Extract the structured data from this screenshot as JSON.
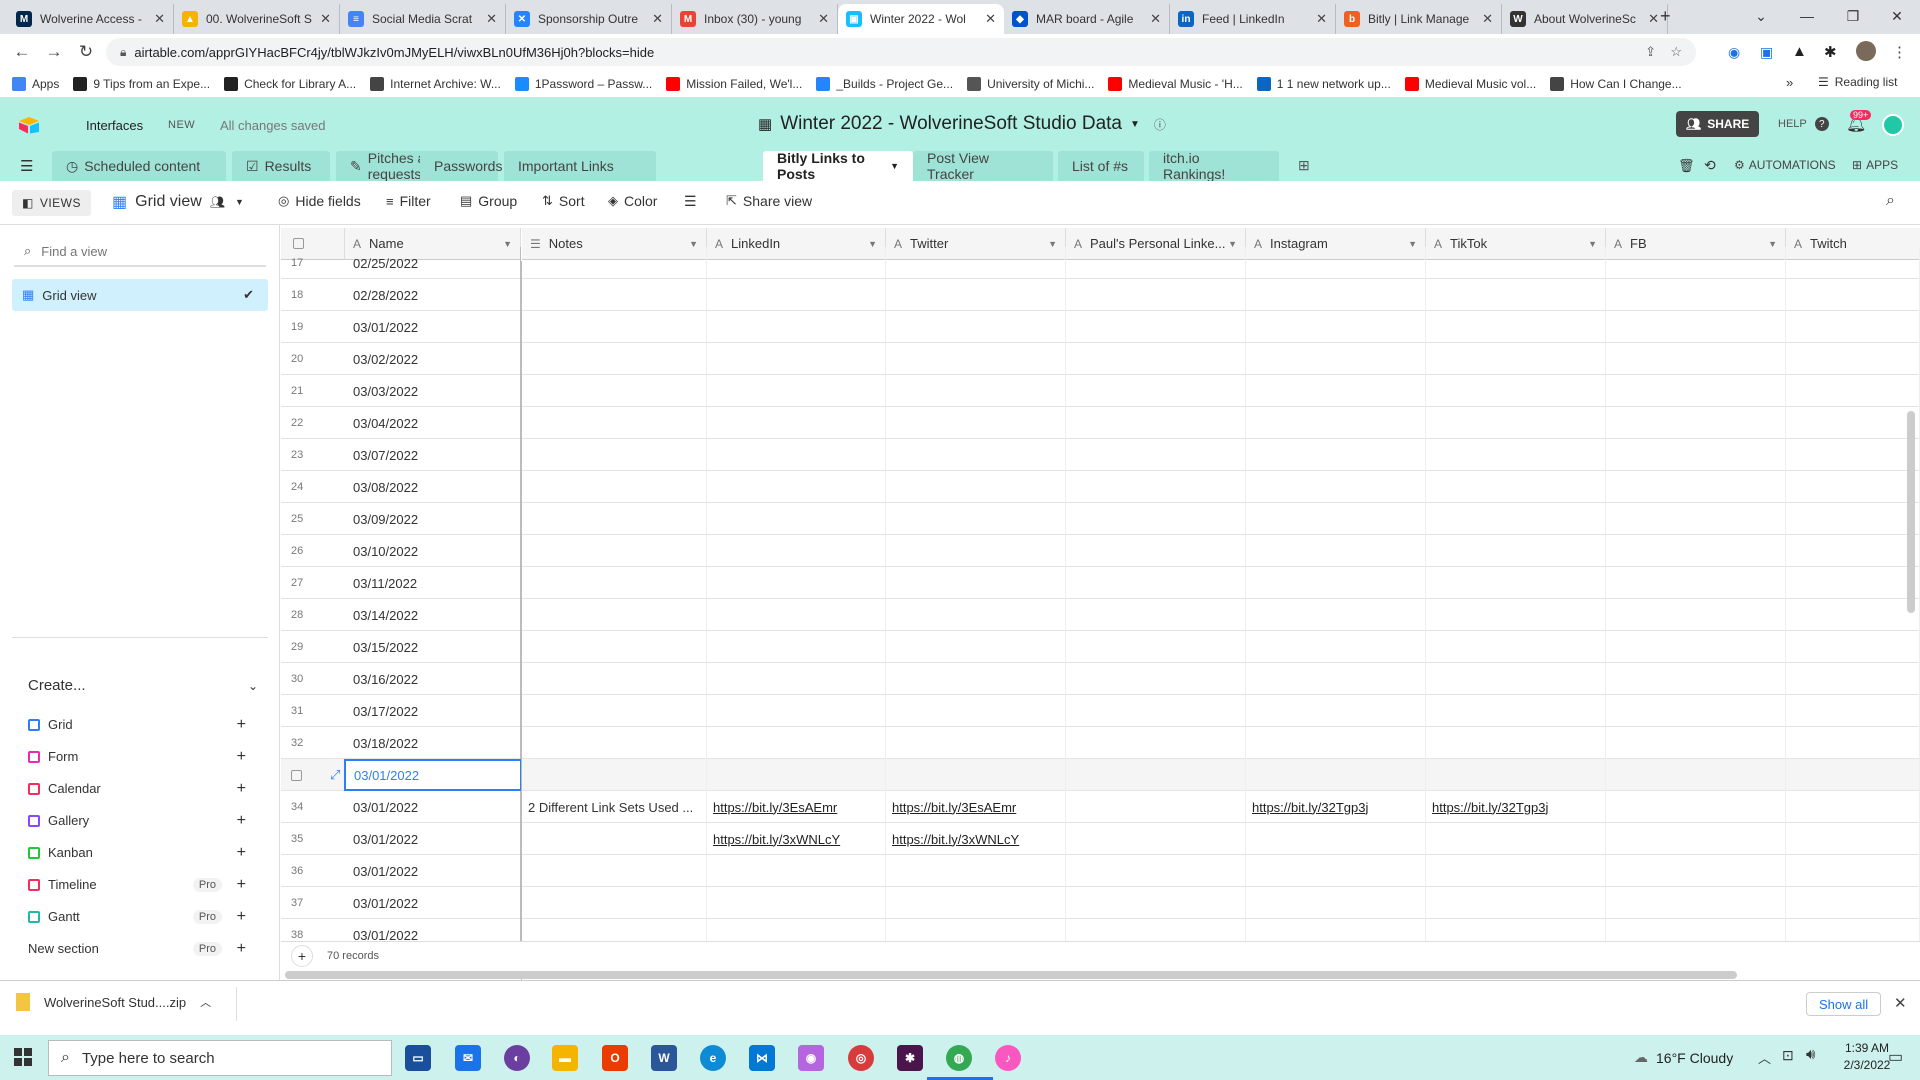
{
  "browser": {
    "tabs": [
      {
        "title": "Wolverine Access -",
        "color": "#00274c",
        "glyph": "M"
      },
      {
        "title": "00. WolverineSoft S",
        "color": "#f4b400",
        "glyph": "▲"
      },
      {
        "title": "Social Media Scrat",
        "color": "#4285f4",
        "glyph": "≡"
      },
      {
        "title": "Sponsorship Outre",
        "color": "#2684ff",
        "glyph": "✕"
      },
      {
        "title": "Inbox (30) - young",
        "color": "#ea4335",
        "glyph": "M"
      },
      {
        "title": "Winter 2022 - Wol",
        "color": "#18bfff",
        "glyph": "▣"
      },
      {
        "title": "MAR board - Agile",
        "color": "#0052cc",
        "glyph": "◆"
      },
      {
        "title": "Feed | LinkedIn",
        "color": "#0a66c2",
        "glyph": "in"
      },
      {
        "title": "Bitly | Link Manage",
        "color": "#ee6123",
        "glyph": "b"
      },
      {
        "title": "About WolverineSc",
        "color": "#333333",
        "glyph": "W"
      }
    ],
    "new_tab": "+",
    "url": "airtable.com/apprGIYHacBFCr4jy/tblWJkzIv0mJMyELH/viwxBLn0UfM36Hj0h?blocks=hide",
    "bookmarks": [
      {
        "label": "Apps",
        "color": "#4285f4"
      },
      {
        "label": "9 Tips from an Expe...",
        "color": "#222222"
      },
      {
        "label": "Check for Library A...",
        "color": "#222222"
      },
      {
        "label": "Internet Archive: W...",
        "color": "#444444"
      },
      {
        "label": "1Password – Passw...",
        "color": "#1a8cff"
      },
      {
        "label": "Mission Failed, We'l...",
        "color": "#ff0000"
      },
      {
        "label": "_Builds - Project Ge...",
        "color": "#2684ff"
      },
      {
        "label": "University of Michi...",
        "color": "#555555"
      },
      {
        "label": "Medieval Music - 'H...",
        "color": "#ff0000"
      },
      {
        "label": "1 1 new network up...",
        "color": "#0a66c2"
      },
      {
        "label": "Medieval Music vol...",
        "color": "#ff0000"
      },
      {
        "label": "How Can I Change...",
        "color": "#444444"
      }
    ],
    "more_bookmarks": "»",
    "reading_list": "Reading list"
  },
  "airtable": {
    "interfaces": "Interfaces",
    "new_badge": "NEW",
    "saved_status": "All changes saved",
    "base_title": "Winter 2022 - WolverineSoft Studio Data",
    "share": "SHARE",
    "help": "HELP",
    "notif_count": "99+",
    "tables": [
      {
        "label": "Scheduled content",
        "active": false
      },
      {
        "label": "Results",
        "active": false
      },
      {
        "label": "Pitches and requests",
        "active": false
      },
      {
        "label": "Passwords",
        "active": false
      },
      {
        "label": "Important Links",
        "active": false
      },
      {
        "label": "Bitly Links to Posts",
        "active": true
      },
      {
        "label": "Post View Tracker",
        "active": false
      },
      {
        "label": "List of #s",
        "active": false
      },
      {
        "label": "itch.io Rankings!",
        "active": false
      }
    ],
    "automations": "AUTOMATIONS",
    "apps": "APPS"
  },
  "viewbar": {
    "views": "VIEWS",
    "current_view": "Grid view",
    "hide_fields": "Hide fields",
    "filter": "Filter",
    "group": "Group",
    "sort": "Sort",
    "color": "Color",
    "share_view": "Share view"
  },
  "sidebar": {
    "find_placeholder": "Find a view",
    "active_view": "Grid view",
    "create": "Create...",
    "create_items": [
      {
        "label": "Grid",
        "color": "#2d7ff9",
        "pro": ""
      },
      {
        "label": "Form",
        "color": "#e929ba",
        "pro": ""
      },
      {
        "label": "Calendar",
        "color": "#f82b60",
        "pro": ""
      },
      {
        "label": "Gallery",
        "color": "#8b46ff",
        "pro": ""
      },
      {
        "label": "Kanban",
        "color": "#20c933",
        "pro": ""
      },
      {
        "label": "Timeline",
        "color": "#f82b60",
        "pro": "Pro"
      },
      {
        "label": "Gantt",
        "color": "#20b8a6",
        "pro": "Pro"
      },
      {
        "label": "New section",
        "color": "",
        "pro": "Pro"
      }
    ]
  },
  "grid": {
    "columns": [
      "Name",
      "Notes",
      "LinkedIn",
      "Twitter",
      "Paul's Personal Linke...",
      "Instagram",
      "TikTok",
      "FB",
      "Twitch"
    ],
    "rows": [
      {
        "num": "17",
        "name": "02/25/2022",
        "cells": [
          "",
          "",
          "",
          "",
          "",
          "",
          "",
          ""
        ]
      },
      {
        "num": "18",
        "name": "02/28/2022",
        "cells": [
          "",
          "",
          "",
          "",
          "",
          "",
          "",
          ""
        ]
      },
      {
        "num": "19",
        "name": "03/01/2022",
        "cells": [
          "",
          "",
          "",
          "",
          "",
          "",
          "",
          ""
        ]
      },
      {
        "num": "20",
        "name": "03/02/2022",
        "cells": [
          "",
          "",
          "",
          "",
          "",
          "",
          "",
          ""
        ]
      },
      {
        "num": "21",
        "name": "03/03/2022",
        "cells": [
          "",
          "",
          "",
          "",
          "",
          "",
          "",
          ""
        ]
      },
      {
        "num": "22",
        "name": "03/04/2022",
        "cells": [
          "",
          "",
          "",
          "",
          "",
          "",
          "",
          ""
        ]
      },
      {
        "num": "23",
        "name": "03/07/2022",
        "cells": [
          "",
          "",
          "",
          "",
          "",
          "",
          "",
          ""
        ]
      },
      {
        "num": "24",
        "name": "03/08/2022",
        "cells": [
          "",
          "",
          "",
          "",
          "",
          "",
          "",
          ""
        ]
      },
      {
        "num": "25",
        "name": "03/09/2022",
        "cells": [
          "",
          "",
          "",
          "",
          "",
          "",
          "",
          ""
        ]
      },
      {
        "num": "26",
        "name": "03/10/2022",
        "cells": [
          "",
          "",
          "",
          "",
          "",
          "",
          "",
          ""
        ]
      },
      {
        "num": "27",
        "name": "03/11/2022",
        "cells": [
          "",
          "",
          "",
          "",
          "",
          "",
          "",
          ""
        ]
      },
      {
        "num": "28",
        "name": "03/14/2022",
        "cells": [
          "",
          "",
          "",
          "",
          "",
          "",
          "",
          ""
        ]
      },
      {
        "num": "29",
        "name": "03/15/2022",
        "cells": [
          "",
          "",
          "",
          "",
          "",
          "",
          "",
          ""
        ]
      },
      {
        "num": "30",
        "name": "03/16/2022",
        "cells": [
          "",
          "",
          "",
          "",
          "",
          "",
          "",
          ""
        ]
      },
      {
        "num": "31",
        "name": "03/17/2022",
        "cells": [
          "",
          "",
          "",
          "",
          "",
          "",
          "",
          ""
        ]
      },
      {
        "num": "32",
        "name": "03/18/2022",
        "cells": [
          "",
          "",
          "",
          "",
          "",
          "",
          "",
          ""
        ]
      },
      {
        "num": "",
        "name": "03/01/2022",
        "selected": true,
        "cells": [
          "",
          "",
          "",
          "",
          "",
          "",
          "",
          ""
        ]
      },
      {
        "num": "34",
        "name": "03/01/2022",
        "cells": [
          "2 Different Link Sets Used ...",
          "https://bit.ly/3EsAEmr",
          "https://bit.ly/3EsAEmr",
          "",
          "https://bit.ly/32Tgp3j",
          "https://bit.ly/32Tgp3j",
          "",
          ""
        ]
      },
      {
        "num": "35",
        "name": "03/01/2022",
        "cells": [
          "",
          "https://bit.ly/3xWNLcY",
          "https://bit.ly/3xWNLcY",
          "",
          "",
          "",
          "",
          ""
        ]
      },
      {
        "num": "36",
        "name": "03/01/2022",
        "cells": [
          "",
          "",
          "",
          "",
          "",
          "",
          "",
          ""
        ]
      },
      {
        "num": "37",
        "name": "03/01/2022",
        "cells": [
          "",
          "",
          "",
          "",
          "",
          "",
          "",
          ""
        ]
      },
      {
        "num": "38",
        "name": "03/01/2022",
        "cells": [
          "",
          "",
          "",
          "",
          "",
          "",
          "",
          ""
        ]
      }
    ],
    "record_count": "70 records"
  },
  "download": {
    "file": "WolverineSoft Stud....zip",
    "show_all": "Show all"
  },
  "taskbar": {
    "search_placeholder": "Type here to search",
    "weather": "16°F  Cloudy",
    "time": "1:39 AM",
    "date": "2/3/2022"
  }
}
